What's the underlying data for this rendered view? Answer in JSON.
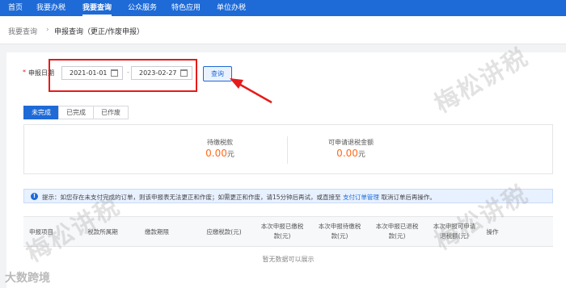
{
  "nav": {
    "items": [
      "首页",
      "我要办税",
      "我要查询",
      "公众服务",
      "特色应用",
      "单位办税"
    ],
    "active": "我要查询"
  },
  "breadcrumb": {
    "root": "我要查询",
    "separator": "›",
    "current": "申报查询（更正/作废申报）"
  },
  "form": {
    "required_mark": "*",
    "date_label": "申报日期",
    "start_date": "2021-01-01",
    "end_date": "2023-02-27",
    "range_separator": "-",
    "query_button": "查询"
  },
  "tabs": [
    "未完成",
    "已完成",
    "已作废"
  ],
  "summary": {
    "unpaid_label": "待缴税款",
    "unpaid_value": "0.00",
    "refund_label": "可申请退税金额",
    "refund_value": "0.00",
    "unit": "元"
  },
  "notice": {
    "prefix": "提示：如您存在未支付完成的订单，则该申报表无法更正和作废；如需更正和作废，请15分钟后再试，或直接至",
    "link": "支付订单管理",
    "suffix": "取消订单后再操作。"
  },
  "table": {
    "headers": [
      [
        "申报项目"
      ],
      [
        "税款所属期"
      ],
      [
        "缴款期限"
      ],
      [
        "应缴税款(元)"
      ],
      [
        "本次申报已缴税",
        "款(元)"
      ],
      [
        "本次申报待缴税",
        "款(元)"
      ],
      [
        "本次申报已退税",
        "款(元)"
      ],
      [
        "本次申报可申请",
        "退税额(元)"
      ],
      [
        "操作"
      ]
    ],
    "empty_text": "暂无数据可以展示"
  },
  "watermark": {
    "text": "梅松讲税",
    "logo": "大数跨境"
  },
  "colors": {
    "primary": "#1e6ad6",
    "highlight_frame": "#e61b1b",
    "amount": "#ff6a1a"
  }
}
